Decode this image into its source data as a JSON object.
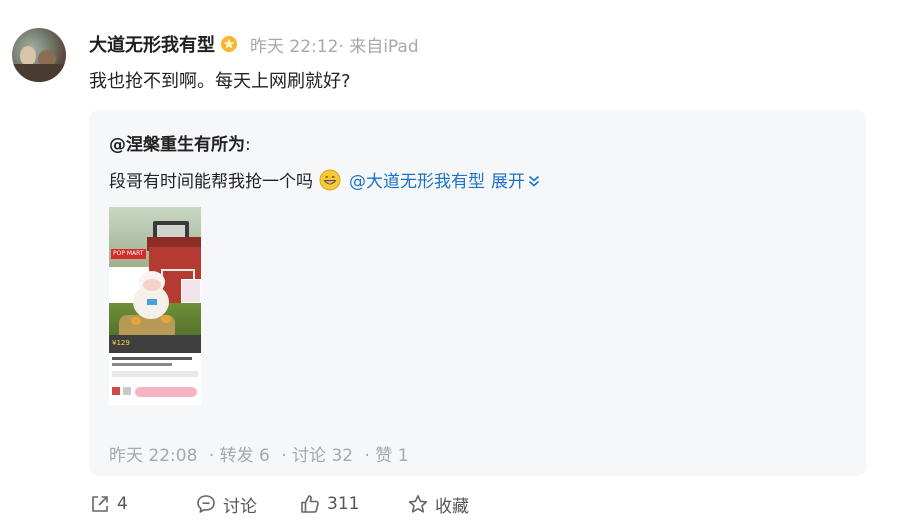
{
  "post": {
    "username": "大道无形我有型",
    "meta": "昨天 22:12· 来自iPad",
    "text": "我也抢不到啊。每天上网刷就好?"
  },
  "repost": {
    "author_handle": "@涅槃重生有所为",
    "author_colon": ":",
    "text": "段哥有时间能帮我抢一个吗",
    "mention": "@大道无形我有型",
    "expand_label": "展开",
    "thumbnail": {
      "brand": "POP MART",
      "price": "¥129"
    },
    "meta": {
      "time": "昨天 22:08",
      "reposts": "· 转发 6",
      "comments": "· 讨论 32",
      "likes": "· 赞 1"
    }
  },
  "actions": {
    "repost_count": "4",
    "comment_label": "讨论",
    "like_count": "311",
    "favorite_label": "收藏"
  },
  "icons": {
    "badge": "vip-badge-icon",
    "emoji": "grin-emoji-icon",
    "expand": "chevron-down-icon",
    "repost": "share-icon",
    "comment": "comment-icon",
    "like": "thumbs-up-icon",
    "favorite": "star-icon"
  },
  "colors": {
    "link": "#1a73c8",
    "muted": "#a8a8a8",
    "card_bg": "#f6f7f9"
  }
}
